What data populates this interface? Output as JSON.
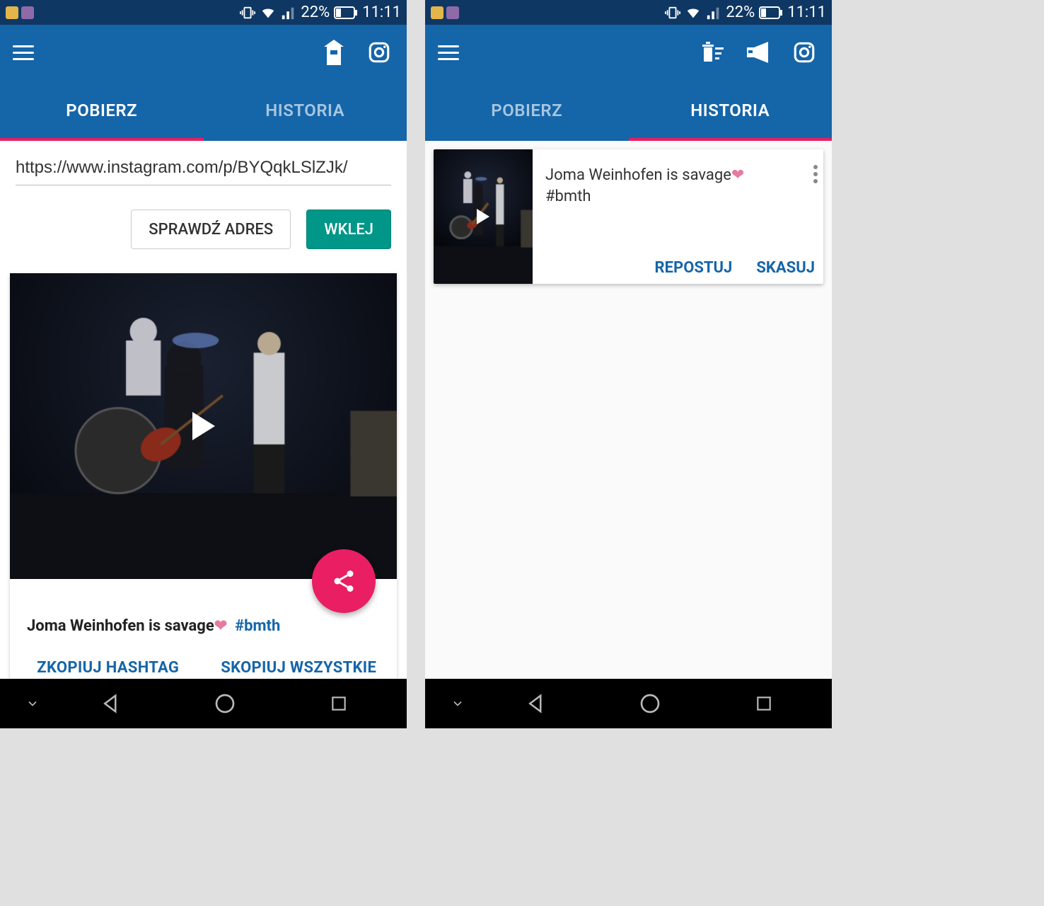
{
  "statusbar": {
    "battery_pct": "22%",
    "time": "11:11"
  },
  "tabs": {
    "download": "POBIERZ",
    "history": "HISTORIA"
  },
  "download_view": {
    "url_value": "https://www.instagram.com/p/BYQqkLSlZJk/",
    "check_btn": "SPRAWDŹ ADRES",
    "paste_btn": "WKLEJ",
    "caption_text": "Joma Weinhofen is savage",
    "caption_hashtag": "#bmth",
    "copy_hashtag": "ZKOPIUJ HASHTAG",
    "copy_all": "SKOPIUJ WSZYSTKIE"
  },
  "history_view": {
    "item_caption": "Joma Weinhofen is savage",
    "item_hashtag": "#bmth",
    "repost_btn": "REPOSTUJ",
    "delete_btn": "SKASUJ"
  }
}
